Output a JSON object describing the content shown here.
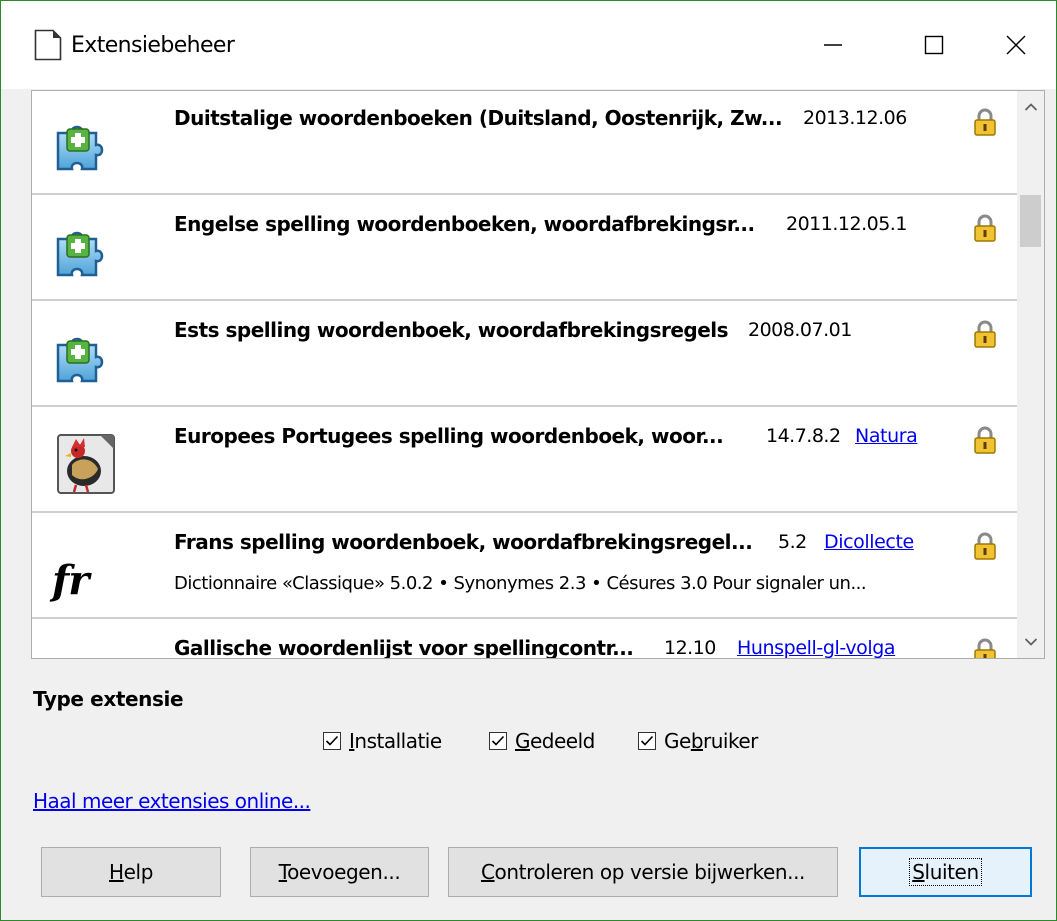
{
  "window": {
    "title": "Extensiebeheer",
    "controls": [
      "minimize-icon",
      "maximize-icon",
      "close-icon"
    ]
  },
  "extensions": [
    {
      "name": "Duitstalige woordenboeken (Duitsland, Oostenrijk, Zw...",
      "version": "2013.12.06",
      "publisher": "",
      "description": "",
      "icon": "puzzle-piece-icon"
    },
    {
      "name": "Engelse spelling woordenboeken, woordafbrekingsr...",
      "version": "2011.12.05.1",
      "publisher": "",
      "description": "",
      "icon": "puzzle-piece-icon"
    },
    {
      "name": "Ests spelling woordenboek, woordafbrekingsregels",
      "version": "2008.07.01",
      "publisher": "",
      "description": "",
      "icon": "puzzle-piece-icon"
    },
    {
      "name": "Europees Portugees spelling woordenboek, woor...",
      "version": "14.7.8.2",
      "publisher": "Natura",
      "description": "",
      "icon": "rooster-icon"
    },
    {
      "name": "Frans spelling woordenboek, woordafbrekingsregel...",
      "version": "5.2",
      "publisher": "Dicollecte",
      "description": "Dictionnaire «Classique» 5.0.2 • Synonymes 2.3 • Césures 3.0  Pour signaler un...",
      "icon": "fr-text-icon",
      "icon_text": "fr"
    },
    {
      "name": "Gallische woordenlijst voor spellingcontr...",
      "version": "12.10",
      "publisher": "Hunspell-gl-volga",
      "description": "",
      "icon": "puzzle-piece-icon"
    }
  ],
  "lock_icon": "padlock-icon",
  "scrollbar": {
    "up_icon": "chevron-up-icon",
    "down_icon": "chevron-down-icon"
  },
  "filter": {
    "title": "Type extensie",
    "options": [
      {
        "label_before": "",
        "mnemonic": "I",
        "label_after": "nstallatie",
        "checked": true
      },
      {
        "label_before": "",
        "mnemonic": "G",
        "label_after": "edeeld",
        "checked": true
      },
      {
        "label_before": "Ge",
        "mnemonic": "b",
        "label_after": "ruiker",
        "checked": true
      }
    ]
  },
  "online_link": "Haal meer extensies online...",
  "buttons": {
    "help": {
      "mnemonic": "H",
      "rest": "elp"
    },
    "add": {
      "mnemonic": "T",
      "rest": "oevoegen..."
    },
    "update": {
      "mnemonic": "C",
      "rest": "ontroleren op versie bijwerken..."
    },
    "close": {
      "mnemonic": "S",
      "rest": "luiten"
    }
  }
}
